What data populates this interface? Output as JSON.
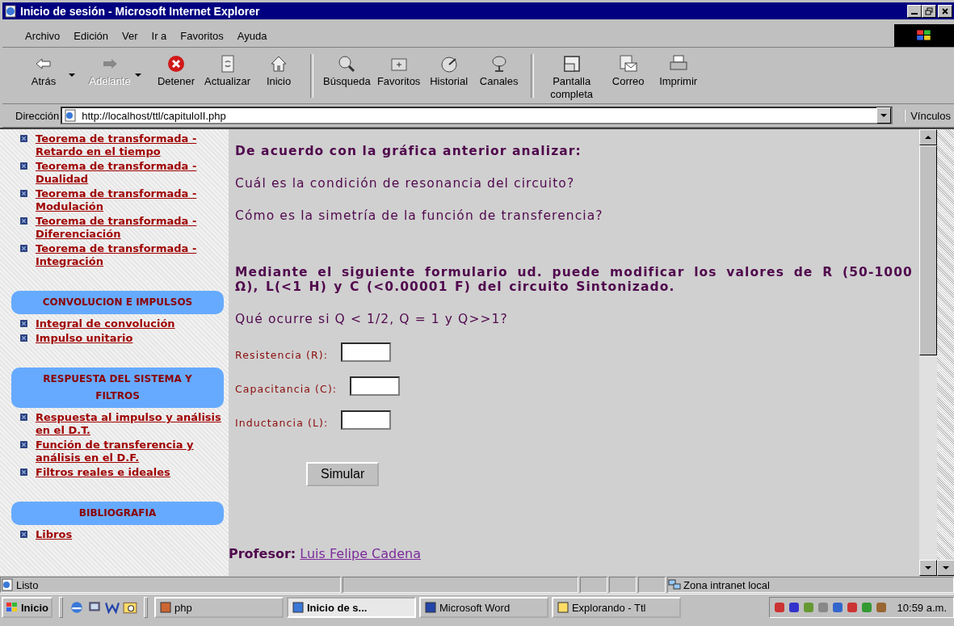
{
  "window": {
    "title": "Inicio de sesión - Microsoft Internet Explorer"
  },
  "menu": [
    "Archivo",
    "Edición",
    "Ver",
    "Ir a",
    "Favoritos",
    "Ayuda"
  ],
  "toolbar": {
    "groups": [
      [
        {
          "label": "Atrás",
          "disabled": false,
          "dropdown": true
        },
        {
          "label": "Adelante",
          "disabled": true,
          "dropdown": true
        },
        {
          "label": "Detener",
          "disabled": false,
          "dropdown": false
        },
        {
          "label": "Actualizar",
          "disabled": false,
          "dropdown": false
        },
        {
          "label": "Inicio",
          "disabled": false,
          "dropdown": false
        }
      ],
      [
        {
          "label": "Búsqueda",
          "disabled": false,
          "dropdown": false
        },
        {
          "label": "Favoritos",
          "disabled": false,
          "dropdown": false
        },
        {
          "label": "Historial",
          "disabled": false,
          "dropdown": false
        },
        {
          "label": "Canales",
          "disabled": false,
          "dropdown": false
        }
      ],
      [
        {
          "label": "Pantalla completa",
          "disabled": false,
          "dropdown": false
        },
        {
          "label": "Correo",
          "disabled": false,
          "dropdown": false
        },
        {
          "label": "Imprimir",
          "disabled": false,
          "dropdown": false
        }
      ]
    ]
  },
  "address": {
    "label": "Dirección",
    "value": "http://localhost/ttl/capituloII.php",
    "links": "Vínculos"
  },
  "sidebar": {
    "sections": [
      {
        "items": [
          "Teorema de transformada - Retardo en el tiempo",
          "Teorema de transformada - Dualidad",
          "Teorema de transformada - Modulación",
          "Teorema de transformada - Diferenciación",
          "Teorema de transformada - Integración"
        ]
      },
      {
        "heading": "CONVOLUCION E IMPULSOS",
        "items": [
          "Integral de convolución",
          "Impulso unitario"
        ]
      },
      {
        "heading": "RESPUESTA DEL SISTEMA Y FILTROS",
        "items": [
          "Respuesta al impulso y análisis en el D.T.",
          "Función de transferencia y análisis en el D.F.",
          "Filtros reales e ideales"
        ]
      },
      {
        "heading": "BIBLIOGRAFIA",
        "items": [
          "Libros"
        ]
      }
    ]
  },
  "content": {
    "heading": "De acuerdo con la gráfica anterior analizar:",
    "questions": [
      "Cuál es la condición de resonancia del circuito?",
      "Cómo es la simetría de la función de transferencia?"
    ],
    "instruction": "Mediante el siguiente formulario ud. puede modificar los valores de R (50-1000 Ω), L(<1 H) y C (<0.00001 F) del circuito Sintonizado.",
    "question": "Qué ocurre si Q < 1/2, Q = 1 y Q>>1?",
    "fields": [
      {
        "label": "Resistencia (R):"
      },
      {
        "label": "Capacitancia (C):"
      },
      {
        "label": "Inductancia (L):"
      }
    ],
    "button": "Simular",
    "professor": {
      "label": "Profesor:",
      "name": "Luis Felipe Cadena"
    }
  },
  "status_bar": {
    "text": "Listo",
    "zone": "Zona intranet local"
  },
  "taskbar": {
    "start": "Inicio",
    "tasks": [
      {
        "label": "php",
        "selected": false
      },
      {
        "label": "Inicio de s...",
        "selected": true
      },
      {
        "label": "Microsoft Word",
        "selected": false
      },
      {
        "label": "Explorando - Ttl",
        "selected": false
      }
    ],
    "clock": "10:59 a.m."
  }
}
